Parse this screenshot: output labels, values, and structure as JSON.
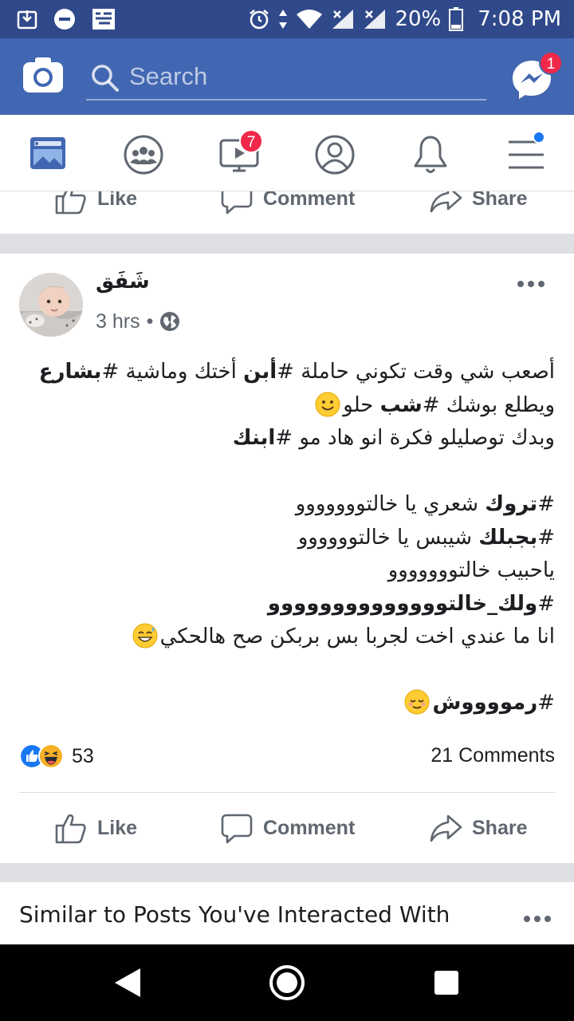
{
  "status_bar": {
    "battery": "20%",
    "time": "7:08 PM"
  },
  "header": {
    "search_placeholder": "Search",
    "messenger_badge": "1"
  },
  "tabs": [
    {
      "name": "news-feed",
      "icon": "news-feed-icon"
    },
    {
      "name": "groups",
      "icon": "groups-icon"
    },
    {
      "name": "watch",
      "icon": "watch-icon",
      "badge": "7"
    },
    {
      "name": "profile",
      "icon": "profile-icon"
    },
    {
      "name": "notifications",
      "icon": "bell-icon"
    },
    {
      "name": "menu",
      "icon": "hamburger-menu-icon"
    }
  ],
  "actions": {
    "like": "Like",
    "comment": "Comment",
    "share": "Share"
  },
  "post": {
    "author": "شَفَق",
    "time": "3 hrs",
    "privacy_icon": "globe-icon",
    "body": {
      "l1a": "أصعب شي وقت تكوني حاملة #",
      "l1b": "أبن",
      "l1c": " أختك وماشية #",
      "l1d": "بشارع",
      "l2a": "ويطلع بوشك #",
      "l2b": "شب",
      "l2c": " حلو",
      "l3a": "وبدك توصليلو فكرة انو هاد مو #",
      "l3b": "ابنك",
      "l5a": "#",
      "l5b": "تروك",
      "l5c": " شعري يا خالتووووووو",
      "l6a": "#",
      "l6b": "بجبلك",
      "l6c": " شيبس يا خالتوووووو",
      "l7": "ياحبيب خالتووووووو",
      "l8a": "#",
      "l8b": "ولك_خالتوووووووووووووو",
      "l9": "انا ما عندي اخت لجربا بس بربكن صح هالحكي",
      "l11a": "#",
      "l11b": "رمووووش"
    },
    "reaction_count": "53",
    "comments_count": "21 Comments"
  },
  "similar": {
    "title": "Similar to Posts You've Interacted With"
  },
  "colors": {
    "brand": "#4267b2",
    "status_bar": "#30498a",
    "badge": "#f02849",
    "action_text": "#606770"
  }
}
